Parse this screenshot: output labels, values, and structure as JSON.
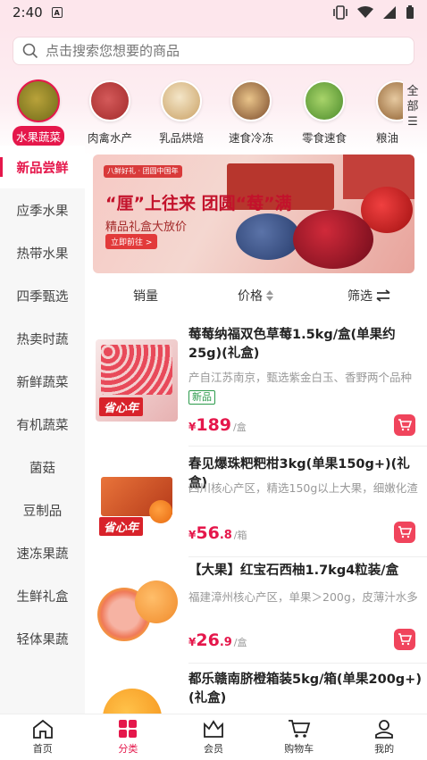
{
  "status": {
    "time": "2:40",
    "a_icon": "A"
  },
  "search": {
    "placeholder": "点击搜索您想要的商品"
  },
  "categories": [
    {
      "label": "水果蔬菜",
      "icon": "durian-image"
    },
    {
      "label": "肉禽水产",
      "icon": "meat-image"
    },
    {
      "label": "乳品烘焙",
      "icon": "ice-cream-image"
    },
    {
      "label": "速食冷冻",
      "icon": "frozen-food-image"
    },
    {
      "label": "零食速食",
      "icon": "snack-image"
    },
    {
      "label": "粮油",
      "icon": "grain-oil-image"
    }
  ],
  "all_button": [
    "全",
    "部",
    "☰"
  ],
  "sidebar": [
    "新品尝鲜",
    "应季水果",
    "热带水果",
    "四季甄选",
    "热卖时蔬",
    "新鲜蔬菜",
    "有机蔬菜",
    "菌菇",
    "豆制品",
    "速冻果蔬",
    "生鲜礼盒",
    "轻体果蔬"
  ],
  "banner": {
    "tag": "八鲜好礼 · 团圆中国年",
    "headline": "“厘”上往来 团圆“莓”满",
    "subline": "精品礼盒大放价",
    "button": "立即前往 >"
  },
  "sort": {
    "sales": "销量",
    "price": "价格",
    "filter": "筛选"
  },
  "products": [
    {
      "title": "莓莓纳福双色草莓1.5kg/盒(单果约25g)(礼盒)",
      "desc": "产自江苏南京，甄选紫金白玉、香野两个品种",
      "badge": "新品",
      "cur": "¥",
      "price_int": "189",
      "price_dec": "",
      "unit": "/盒",
      "ribbon": "省心年"
    },
    {
      "title": "春见爆珠粑粑柑3kg(单果150g+)(礼盒)",
      "desc": "四川核心产区，精选150g以上大果，细嫩化渣",
      "badge": "",
      "cur": "¥",
      "price_int": "56",
      "price_dec": ".8",
      "unit": "/箱",
      "ribbon": "省心年"
    },
    {
      "title": "【大果】红宝石西柚1.7kg4粒装/盒",
      "desc": "福建漳州核心产区，单果＞200g，皮薄汁水多",
      "badge": "",
      "cur": "¥",
      "price_int": "26",
      "price_dec": ".9",
      "unit": "/盒",
      "ribbon": ""
    },
    {
      "title": "都乐赣南脐橙箱装5kg/箱(单果200g+)(礼盒)",
      "desc": "",
      "badge": "",
      "cur": "",
      "price_int": "",
      "price_dec": "",
      "unit": "",
      "ribbon": ""
    }
  ],
  "bottom_nav": [
    "首页",
    "分类",
    "会员",
    "购物车",
    "我的"
  ],
  "colors": {
    "accent": "#e5174b",
    "new_badge": "#2a9a4a"
  }
}
